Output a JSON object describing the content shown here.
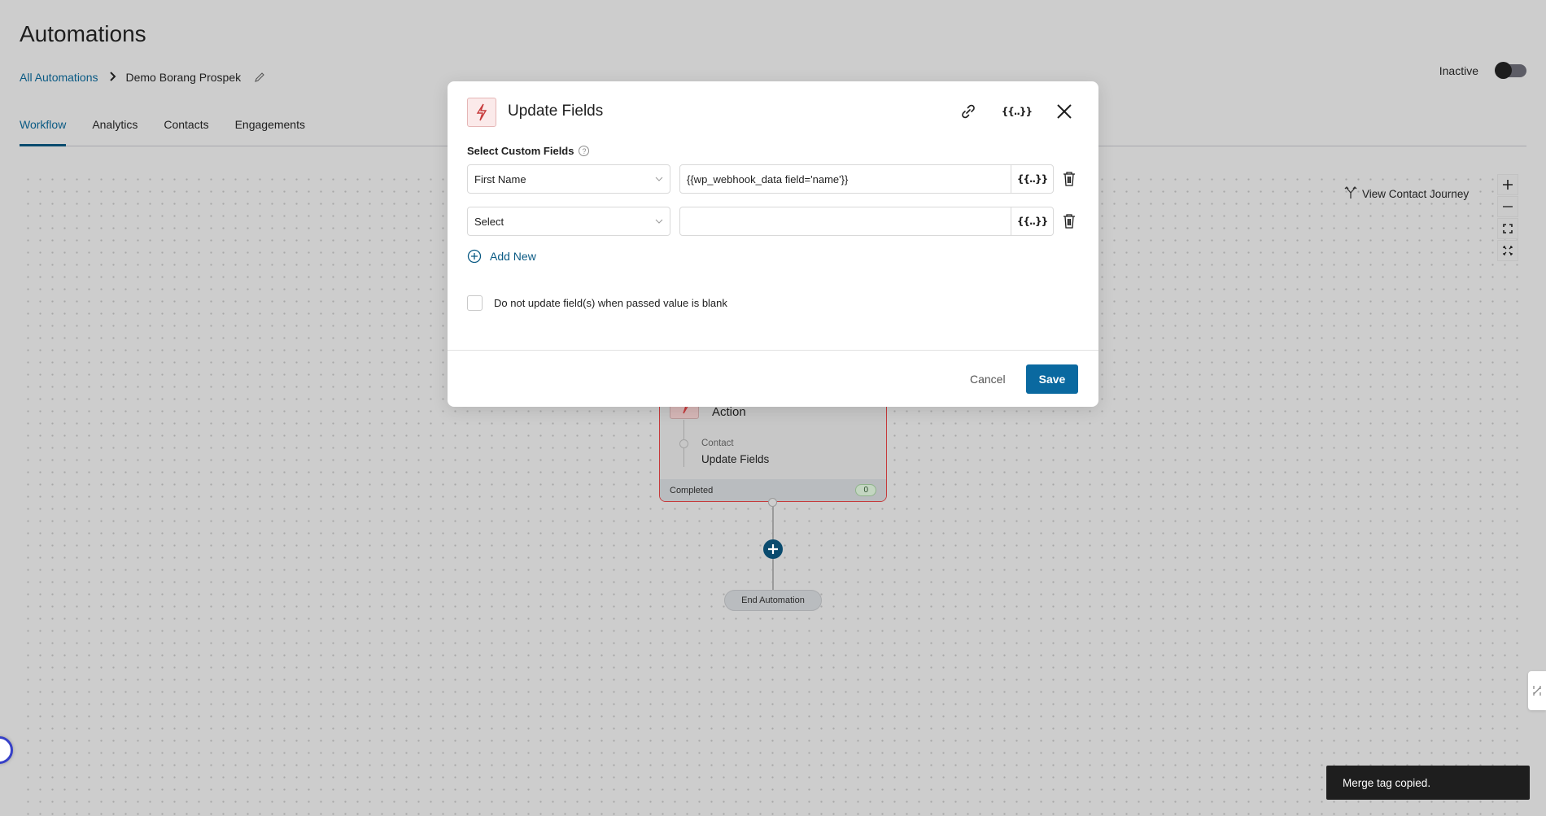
{
  "header": {
    "title": "Automations",
    "breadcrumb": {
      "root": "All Automations",
      "current": "Demo Borang Prospek"
    },
    "status_label": "Inactive",
    "status_active": false
  },
  "tabs": [
    {
      "label": "Workflow",
      "active": true
    },
    {
      "label": "Analytics",
      "active": false
    },
    {
      "label": "Contacts",
      "active": false
    },
    {
      "label": "Engagements",
      "active": false
    }
  ],
  "canvas": {
    "journey_label": "View Contact Journey",
    "zoom_controls": [
      "zoom-in",
      "zoom-out",
      "fit-view",
      "fullscreen"
    ],
    "node": {
      "type": "Action",
      "category": "Contact",
      "name": "Update Fields",
      "status_label": "Completed",
      "count": "0"
    },
    "end_label": "End Automation"
  },
  "modal": {
    "title": "Update Fields",
    "section_label": "Select Custom Fields",
    "help_glyph": "?",
    "merge_glyph": "{{..}}",
    "rows": [
      {
        "field": "First Name",
        "value": "{{wp_webhook_data field='name'}}"
      },
      {
        "field": "Select",
        "value": ""
      }
    ],
    "add_new_label": "Add New",
    "checkbox_label": "Do not update field(s) when passed value is blank",
    "checkbox_checked": false,
    "cancel_label": "Cancel",
    "save_label": "Save"
  },
  "toast": {
    "message": "Merge tag copied."
  },
  "colors": {
    "accent": "#0a69a0",
    "link": "#0a5a84",
    "danger": "#c6393a",
    "background": "#cdcdcd"
  }
}
